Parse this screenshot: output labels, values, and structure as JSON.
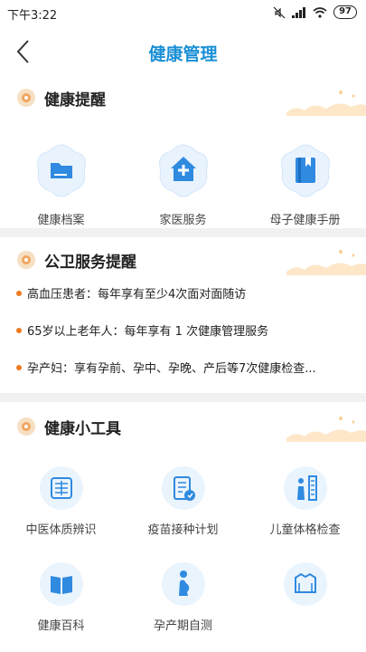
{
  "status_bar": {
    "time": "下午3:22",
    "battery": "97"
  },
  "nav": {
    "title": "健康管理"
  },
  "reminder": {
    "title": "健康提醒",
    "items": [
      {
        "label": "健康档案",
        "icon": "folder-icon"
      },
      {
        "label": "家医服务",
        "icon": "house-plus-icon"
      },
      {
        "label": "母子健康手册",
        "icon": "handbook-icon"
      }
    ]
  },
  "public_health": {
    "title": "公卫服务提醒",
    "notices": [
      "高血压患者：每年享有至少4次面对面随访",
      "65岁以上老年人：每年享有 1 次健康管理服务",
      "孕产妇：享有孕前、孕中、孕晚、产后等7次健康检查..."
    ]
  },
  "tools": {
    "title": "健康小工具",
    "items": [
      {
        "label": "中医体质辨识",
        "icon": "tcm-icon"
      },
      {
        "label": "疫苗接种计划",
        "icon": "vaccine-plan-icon"
      },
      {
        "label": "儿童体格检查",
        "icon": "child-height-icon"
      },
      {
        "label": "健康百科",
        "icon": "book-icon"
      },
      {
        "label": "孕产期自测",
        "icon": "pregnancy-icon"
      },
      {
        "label": "",
        "icon": "clothing-icon"
      }
    ]
  },
  "colors": {
    "accent": "#1a8fd6",
    "icon_blue": "#2f8ae0",
    "bullet": "#f07a1e",
    "divider": "#f1f1f1"
  }
}
